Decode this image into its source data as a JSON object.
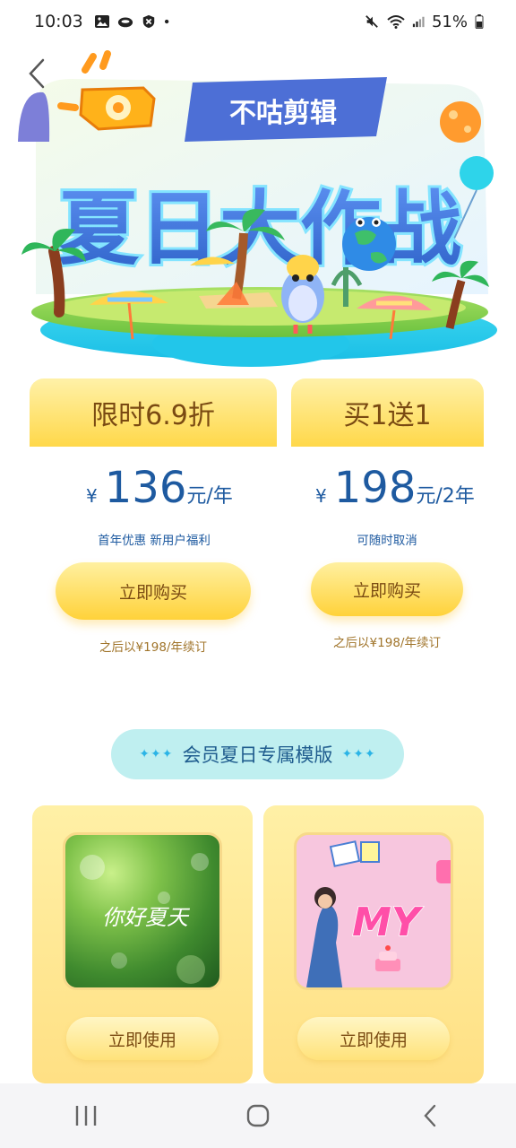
{
  "status_bar": {
    "time": "10:03",
    "battery": "51%",
    "icons": [
      "gallery-icon",
      "cloud-icon",
      "shield-icon",
      "dot-icon",
      "mute-icon",
      "wifi-icon",
      "signal-icon",
      "battery-icon"
    ]
  },
  "banner": {
    "brand": "不咕剪辑",
    "headline": "夏日大作战"
  },
  "plans": [
    {
      "badge": "限时6.9折",
      "currency": "¥",
      "price": "136",
      "unit": "元/年",
      "note": "首年优惠 新用户福利",
      "button": "立即购买",
      "renew": "之后以¥198/年续订"
    },
    {
      "badge": "买1送1",
      "currency": "¥",
      "price": "198",
      "unit": "元/2年",
      "note": "可随时取消",
      "button": "立即购买",
      "renew": "之后以¥198/年续订"
    }
  ],
  "templates_section": {
    "title": "会员夏日专属模版",
    "items": [
      {
        "art_text": "你好夏天",
        "button": "立即使用"
      },
      {
        "art_text": "MY",
        "button": "立即使用"
      }
    ]
  },
  "colors": {
    "gold": "#ffd84a",
    "price_blue": "#1e5aa0",
    "pill_bg": "#bfeff0",
    "brown_text": "#7a4a12"
  }
}
